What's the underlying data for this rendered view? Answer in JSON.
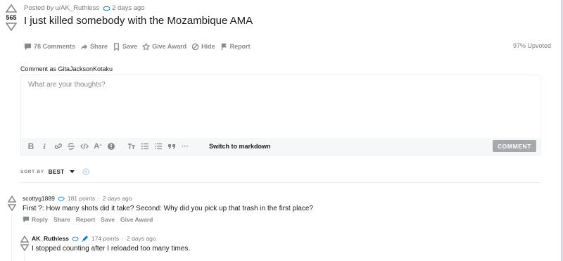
{
  "post": {
    "score": "565",
    "meta_prefix": "Posted by",
    "author": "u/AK_Ruthless",
    "time": "2 days ago",
    "title": "I just killed somebody with the Mozambique AMA",
    "upvoted": "97% Upvoted",
    "actions": {
      "comments": "78 Comments",
      "share": "Share",
      "save": "Save",
      "give_award": "Give Award",
      "hide": "Hide",
      "report": "Report"
    }
  },
  "composer": {
    "comment_as": "Comment as GitaJacksonKotaku",
    "placeholder": "What are your thoughts?",
    "toolbar": {
      "bold": "B",
      "italic": "i",
      "superscript": "A",
      "more": "···",
      "switch_markdown": "Switch to markdown"
    },
    "submit_label": "COMMENT"
  },
  "sort": {
    "label": "SORT BY",
    "value": "BEST"
  },
  "comments": [
    {
      "user": "scottyg1889",
      "points": "181 points",
      "time": "2 days ago",
      "body": "First ?: How many shots did it take? Second: Why did you pick up that trash in the first place?",
      "actions": {
        "reply": "Reply",
        "share": "Share",
        "report": "Report",
        "save": "Save",
        "give_award": "Give Award"
      }
    },
    {
      "user": "AK_Ruthless",
      "points": "174 points",
      "time": "2 days ago",
      "body": "I stopped counting after I reloaded too many times."
    }
  ],
  "colors": {
    "background": "#dae0e6",
    "card": "#ffffff",
    "muted_text": "#878a8c",
    "button_disabled": "#a6a9ab",
    "snoo_blue": "#0079d3"
  }
}
